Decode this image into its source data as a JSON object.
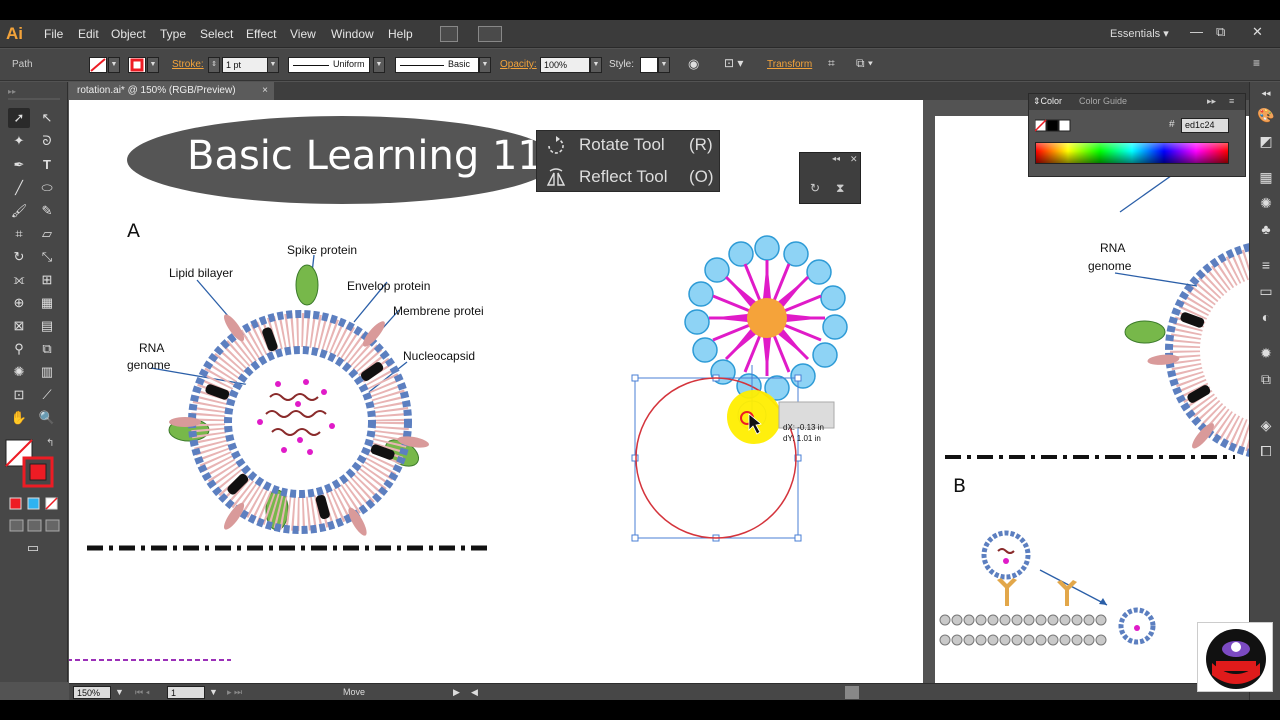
{
  "app": {
    "logo": "Ai"
  },
  "menu": [
    "File",
    "Edit",
    "Object",
    "Type",
    "Select",
    "Effect",
    "View",
    "Window",
    "Help"
  ],
  "workspace": "Essentials",
  "window_controls": {
    "minimize": "—",
    "restore": "⧉",
    "close": "✕"
  },
  "control_bar": {
    "selection_type": "Path",
    "stroke_label": "Stroke:",
    "stroke_weight": "1 pt",
    "profile": "Uniform",
    "brush": "Basic",
    "opacity_label": "Opacity:",
    "opacity_value": "100%",
    "style_label": "Style:",
    "transform_label": "Transform"
  },
  "document_tab": {
    "title": "rotation.ai* @ 150% (RGB/Preview)",
    "close": "×"
  },
  "status_bar": {
    "zoom": "150%",
    "artboard": "1",
    "tool": "Move"
  },
  "color_panel": {
    "tab_color": "Color",
    "tab_guide": "Color Guide",
    "hex_symbol": "#",
    "hex_value": "ed1c24"
  },
  "tool_popup": {
    "items": [
      {
        "label": "Rotate Tool",
        "key": "(R)"
      },
      {
        "label": "Reflect Tool",
        "key": "(O)"
      }
    ]
  },
  "banner": {
    "title": "Basic Learning 11:"
  },
  "artboard_left": {
    "section": "A",
    "labels": {
      "spike": "Spike protein",
      "lipid": "Lipid bilayer",
      "envelop": "Envelop protein",
      "membrane": "Membrene protei",
      "nucleocapsid": "Nucleocapsid",
      "rna1": "RNA",
      "rna2": "genome"
    }
  },
  "artboard_right": {
    "section": "B",
    "rna1": "RNA",
    "rna2": "genome"
  },
  "tooltip": {
    "dx": "dX: -0.13 in",
    "dy": "dY: 1.01 in"
  },
  "colors": {
    "accent_orange": "#f3a33a",
    "selected_red": "#ed1c24",
    "selection_blue": "#4a7fd4"
  }
}
